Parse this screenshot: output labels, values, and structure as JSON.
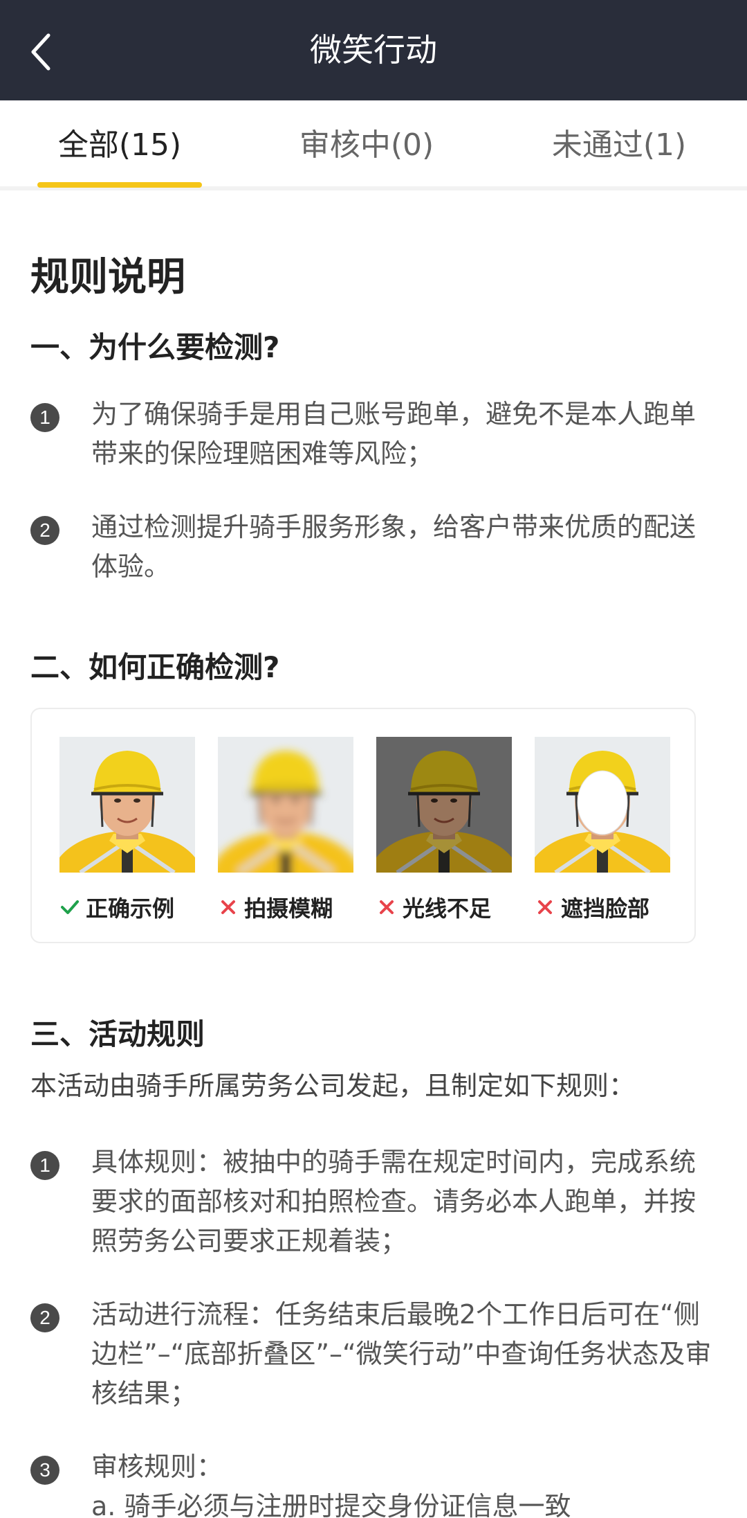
{
  "header": {
    "title": "微笑行动",
    "back_icon": "chevron-left-icon"
  },
  "tabs": [
    {
      "label": "全部(15)",
      "active": true
    },
    {
      "label": "审核中(0)",
      "active": false
    },
    {
      "label": "未通过(1)",
      "active": false
    }
  ],
  "colors": {
    "header_bg": "#292d3a",
    "accent": "#f5c518",
    "ok": "#1fa14b",
    "bad": "#e8434b"
  },
  "rules": {
    "title": "规则说明",
    "section1": {
      "heading": "一、为什么要检测?",
      "items": [
        {
          "num": "1",
          "line1": "为了确保骑手是用自己账号跑单，避免不是本人跑单",
          "line2": "带来的保险理赔困难等风险；"
        },
        {
          "num": "2",
          "line1": "通过检测提升骑手服务形象，给客户带来优质的配送",
          "line2": "体验。"
        }
      ]
    },
    "section2": {
      "heading": "二、如何正确检测?",
      "examples": [
        {
          "label": "正确示例",
          "mark": "check-icon"
        },
        {
          "label": "拍摄模糊",
          "mark": "cross-icon"
        },
        {
          "label": "光线不足",
          "mark": "cross-icon"
        },
        {
          "label": "遮挡脸部",
          "mark": "cross-icon"
        }
      ]
    },
    "section3": {
      "heading": "三、活动规则",
      "intro": "本活动由骑手所属劳务公司发起，且制定如下规则：",
      "items": [
        {
          "num": "1",
          "line1": "具体规则：被抽中的骑手需在规定时间内，完成系统",
          "line2": "要求的面部核对和拍照检查。请务必本人跑单，并按",
          "line3": "照劳务公司要求正规着装；"
        },
        {
          "num": "2",
          "line1": "活动进行流程：任务结束后最晚2个工作日后可在“侧",
          "line2": "边栏”–“底部折叠区”–“微笑行动”中查询任务状态及审",
          "line3": "核结果；"
        },
        {
          "num": "3",
          "line1": "审核规则：",
          "line2": "a. 骑手必须与注册时提交身份证信息一致"
        }
      ]
    }
  }
}
